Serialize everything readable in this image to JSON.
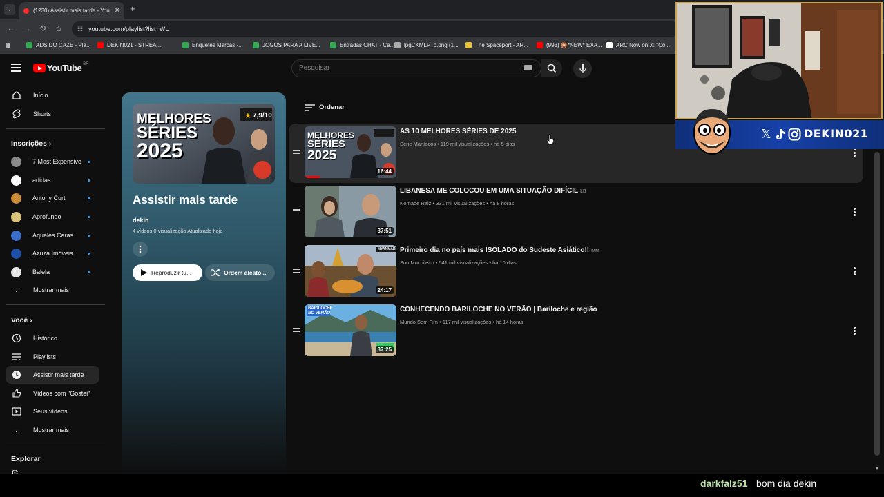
{
  "browser": {
    "tab_title": "(1230) Assistir mais tarde - You",
    "url": "youtube.com/playlist?list=WL",
    "bookmarks": [
      {
        "label": "ADS DO CAZE - Pla...",
        "color": "#34a853"
      },
      {
        "label": "DEKIN021 - STREA...",
        "color": "#ff0000"
      },
      {
        "label": "Enquetes Marcas -...",
        "color": "#34a853"
      },
      {
        "label": "JOGOS PARA A LIVE...",
        "color": "#34a853"
      },
      {
        "label": "Entradas CHAT - Ca...",
        "color": "#34a853"
      },
      {
        "label": "lpqCKMLP_o.png (1...",
        "color": "#aaaaaa"
      },
      {
        "label": "The Spaceport - AR...",
        "color": "#e8c33a"
      },
      {
        "label": "(993) 🎇*NEW* EXA...",
        "color": "#ff0000"
      },
      {
        "label": "ARC Now on X: \"Co...",
        "color": "#ffffff"
      }
    ]
  },
  "youtube": {
    "logo_text": "YouTube",
    "country_code": "BR",
    "search_placeholder": "Pesquisar"
  },
  "sidebar": {
    "main": [
      {
        "label": "Início",
        "icon": "home-icon"
      },
      {
        "label": "Shorts",
        "icon": "shorts-icon"
      }
    ],
    "subscriptions_heading": "Inscrições",
    "subscriptions": [
      {
        "label": "7 Most Expensive",
        "color": "#8a8a8a"
      },
      {
        "label": "adidas",
        "color": "#ffffff"
      },
      {
        "label": "Antony Curti",
        "color": "#c98a3a"
      },
      {
        "label": "Aprofundo",
        "color": "#d9c27a"
      },
      {
        "label": "Aqueles Caras",
        "color": "#3a6ec9"
      },
      {
        "label": "Azuza Imóveis",
        "color": "#1e4fa8"
      },
      {
        "label": "Balela",
        "color": "#e8e8e8"
      }
    ],
    "show_more_1": "Mostrar mais",
    "you_heading": "Você",
    "you_items": [
      {
        "label": "Histórico",
        "icon": "history-icon"
      },
      {
        "label": "Playlists",
        "icon": "playlists-icon"
      },
      {
        "label": "Assistir mais tarde",
        "icon": "watch-later-icon"
      },
      {
        "label": "Vídeos com \"Gostei\"",
        "icon": "like-icon"
      },
      {
        "label": "Seus vídeos",
        "icon": "your-videos-icon"
      }
    ],
    "show_more_2": "Mostrar mais",
    "explore_heading": "Explorar"
  },
  "playlist": {
    "title": "Assistir mais tarde",
    "owner": "dekin",
    "meta": "4 vídeos   0 visualização   Atualizado hoje",
    "thumb_text_1": "MELHORES",
    "thumb_text_2": "SÉRIES",
    "thumb_text_3": "2025",
    "thumb_rating": "7,9/10",
    "play_label": "Reproduzir tu...",
    "shuffle_label": "Ordem aleató..."
  },
  "list": {
    "sort_label": "Ordenar",
    "videos": [
      {
        "title": "AS 10 MELHORES SÉRIES DE 2025",
        "tag": "",
        "channel": "Série Maníacos",
        "views": "119 mil visualizações",
        "age": "há 5 dias",
        "duration": "16:44",
        "thumb_a": "#3a4a5a",
        "thumb_b": "#1a1f26"
      },
      {
        "title": "LIBANESA ME COLOCOU EM UMA SITUAÇÃO DIFÍCIL",
        "tag": "LB",
        "channel": "Nômade Raiz",
        "views": "331 mil visualizações",
        "age": "há 8 horas",
        "duration": "37:51",
        "thumb_a": "#7a8f9a",
        "thumb_b": "#4a5560"
      },
      {
        "title": "Primeiro dia no país mais ISOLADO do Sudeste Asiático!!",
        "tag": "MM",
        "channel": "Sou Mochileiro",
        "views": "541 mil visualizações",
        "age": "há 10 dias",
        "duration": "24:17",
        "thumb_a": "#c99a3a",
        "thumb_b": "#5a7a3a"
      },
      {
        "title": "CONHECENDO BARILOCHE NO VERÃO | Bariloche e região",
        "tag": "",
        "channel": "Mundo Sem Fim",
        "views": "117 mil visualizações",
        "age": "há 14 horas",
        "duration": "37:25",
        "thumb_a": "#5aa0d9",
        "thumb_b": "#3a6a3a"
      }
    ],
    "thumb4_label_1": "BARILOCHE",
    "thumb4_label_2": "NO VERÃO",
    "thumb3_label": "MYANMAR"
  },
  "stream": {
    "banner_name": "DEKIN021",
    "chat_user": "darkfalz51",
    "chat_message": "bom dia dekin"
  }
}
